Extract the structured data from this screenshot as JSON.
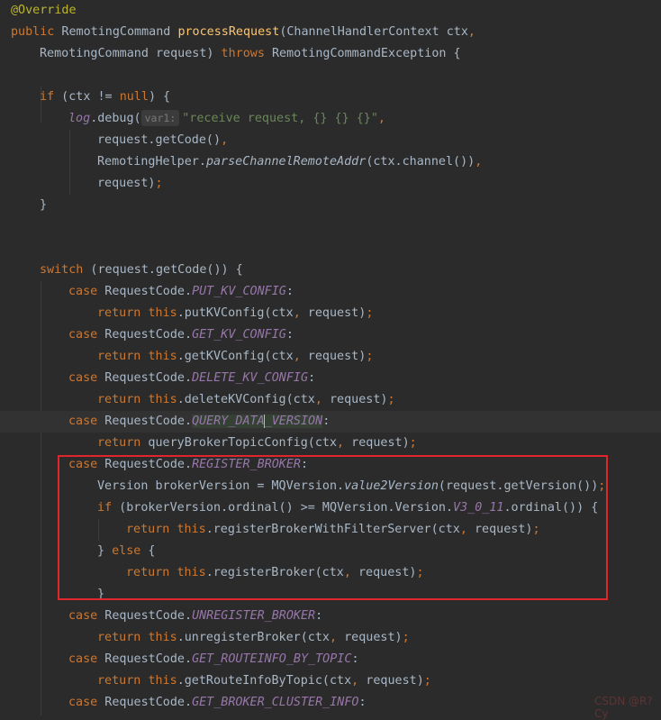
{
  "code": {
    "annotation": "@Override",
    "sig1_public": "public",
    "sig1_type": " RemotingCommand ",
    "sig1_name": "processRequest",
    "sig1_rest": "(ChannelHandlerContext ctx",
    "comma": ",",
    "sig2_a": "RemotingCommand request) ",
    "sig2_throws": "throws",
    "sig2_b": " RemotingCommandException {",
    "if_kw": "if",
    "if_a": " (ctx != ",
    "null_kw": "null",
    "if_b": ") {",
    "log_field": "log",
    "log_debug": ".debug(",
    "hint_var1": "var1:",
    "log_str": "\"receive request, {} {} {}\"",
    "l6": "request.getCode()",
    "l7_a": "RemotingHelper.",
    "l7_call": "parseChannelRemoteAddr",
    "l7_b": "(ctx.channel())",
    "l8": "request)",
    "semicolon": ";",
    "close_brace": "}",
    "switch_kw": "switch",
    "switch_rest": " (request.getCode()) {",
    "case_kw": "case",
    "rc": " RequestCode.",
    "colon": ":",
    "return_kw": "return",
    "this_kw": "this",
    "put_kv": "PUT_KV_CONFIG",
    "put_kv_call": ".putKVConfig(ctx",
    "get_kv": "GET_KV_CONFIG",
    "get_kv_call": ".getKVConfig(ctx",
    "del_kv": "DELETE_KV_CONFIG",
    "del_kv_call": ".deleteKVConfig(ctx",
    "args_request": " request)",
    "qdv_a": "QUERY_DATA",
    "qdv_b": "_VERSION",
    "qdv_call": " queryBrokerTopicConfig(ctx",
    "reg": "REGISTER_BROKER",
    "ver_a": "Version brokerVersion = MQVersion.",
    "ver_call": "value2Version",
    "ver_b": "(request.getVersion())",
    "if2_a": " (brokerVersion.ordinal() >= MQVersion.Version.",
    "v3": "V3_0_11",
    "if2_b": ".ordinal()) {",
    "rbwfs": ".registerBrokerWithFilterServer(ctx",
    "else_a": "} ",
    "else_kw": "else",
    "else_b": " {",
    "rb": ".registerBroker(ctx",
    "unreg": "UNREGISTER_BROKER",
    "unreg_call": ".unregisterBroker(ctx",
    "route": "GET_ROUTEINFO_BY_TOPIC",
    "route_call": ".getRouteInfoByTopic(ctx",
    "cluster": "GET_BROKER_CLUSTER_INFO"
  },
  "watermarks": {
    "bottom_right": "CSDN @R?Cy"
  },
  "colors": {
    "background": "#2b2b2b",
    "keyword": "#cc7832",
    "method": "#ffc66d",
    "string": "#6a8759",
    "constant": "#9876aa",
    "highlight_box": "#e0262d"
  }
}
